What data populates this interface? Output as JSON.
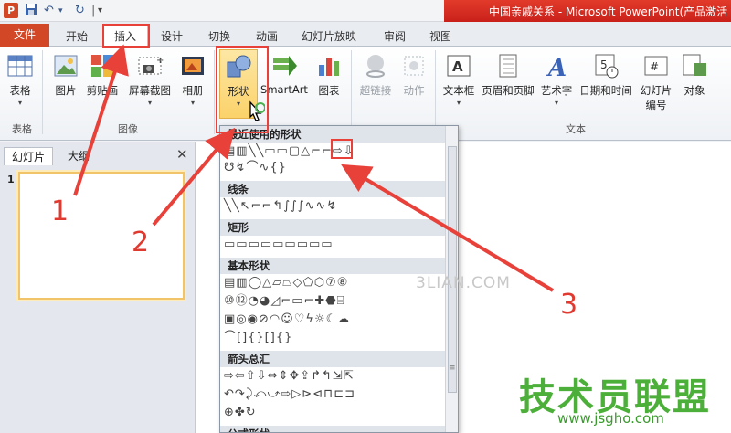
{
  "window": {
    "title": "中国亲戚关系 - Microsoft PowerPoint(产品激活",
    "app_icon": "P"
  },
  "quick_access": {
    "save_icon": "save-icon",
    "undo_icon": "undo-icon",
    "redo_icon": "redo-icon"
  },
  "tabs": [
    {
      "label": "文件"
    },
    {
      "label": "开始"
    },
    {
      "label": "插入"
    },
    {
      "label": "设计"
    },
    {
      "label": "切换"
    },
    {
      "label": "动画"
    },
    {
      "label": "幻灯片放映"
    },
    {
      "label": "审阅"
    },
    {
      "label": "视图"
    }
  ],
  "ribbon": {
    "buttons": [
      {
        "label": "表格",
        "icon": "table-icon"
      },
      {
        "label": "图片",
        "icon": "picture-icon"
      },
      {
        "label": "剪贴画",
        "icon": "clipart-icon"
      },
      {
        "label": "屏幕截图",
        "icon": "screenshot-icon"
      },
      {
        "label": "相册",
        "icon": "album-icon"
      },
      {
        "label": "形状",
        "icon": "shapes-icon"
      },
      {
        "label": "SmartArt",
        "icon": "smartart-icon"
      },
      {
        "label": "图表",
        "icon": "chart-icon"
      },
      {
        "label": "超链接",
        "icon": "hyperlink-icon"
      },
      {
        "label": "动作",
        "icon": "action-icon"
      },
      {
        "label": "文本框",
        "icon": "textbox-icon"
      },
      {
        "label": "页眉和页脚",
        "icon": "header-footer-icon"
      },
      {
        "label": "艺术字",
        "icon": "wordart-icon"
      },
      {
        "label": "日期和时间",
        "icon": "datetime-icon"
      },
      {
        "label": "幻灯片",
        "label2": "编号",
        "icon": "slide-number-icon"
      },
      {
        "label": "对象",
        "icon": "object-icon"
      }
    ],
    "groups": [
      "表格",
      "图像",
      "文本"
    ]
  },
  "left_pane": {
    "tabs": [
      "幻灯片",
      "大纲"
    ],
    "slide_number": "1"
  },
  "shapes_menu": {
    "sections": [
      "最近使用的形状",
      "线条",
      "矩形",
      "基本形状",
      "箭头总汇",
      "公式形状"
    ]
  },
  "annotations": {
    "step1": "1",
    "step2": "2",
    "step3": "3"
  },
  "watermark": "3LIAN.COM",
  "brand": {
    "name": "技术员联盟",
    "url": "www.jsgho.com"
  }
}
